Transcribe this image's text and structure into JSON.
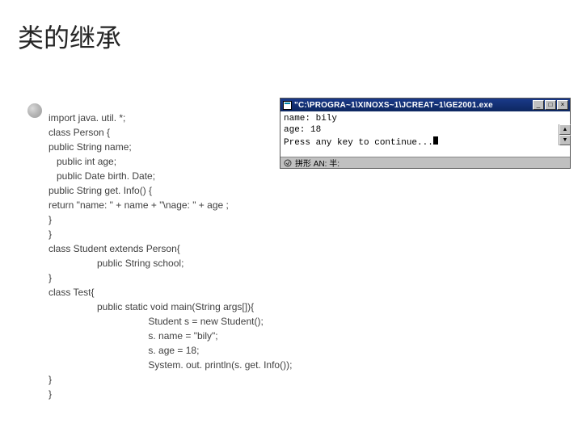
{
  "title": "类的继承",
  "code": {
    "l1": "import java. util. *;",
    "l2": "class Person {",
    "l3": "public String name;",
    "l4": "   public int age;",
    "l5": "   public Date birth. Date;",
    "l6": "public String get. Info() {",
    "l7": "return \"name: \" + name + \"\\nage: \" + age ;",
    "l8": "}",
    "l9": "}",
    "l10": "class Student extends Person{",
    "l11": "                  public String school;",
    "l12": "}",
    "l13": "class Test{",
    "l14": "                  public static void main(String args[]){",
    "l15": "                                     Student s = new Student();",
    "l16": "                                     s. name = \"bily\";",
    "l17": "                                     s. age = 18;",
    "l18": "                                     System. out. println(s. get. Info());",
    "l19": "}",
    "l20": "}"
  },
  "console": {
    "titlebar": "\"C:\\PROGRA~1\\XINOXS~1\\JCREAT~1\\GE2001.exe",
    "line1": "name: bily",
    "line2": "age: 18",
    "line3": "Press any key to continue...",
    "status": "拼形 AN: 半:",
    "btn_min": "_",
    "btn_max": "□",
    "btn_close": "×",
    "arrow_up": "▲",
    "arrow_down": "▼"
  }
}
